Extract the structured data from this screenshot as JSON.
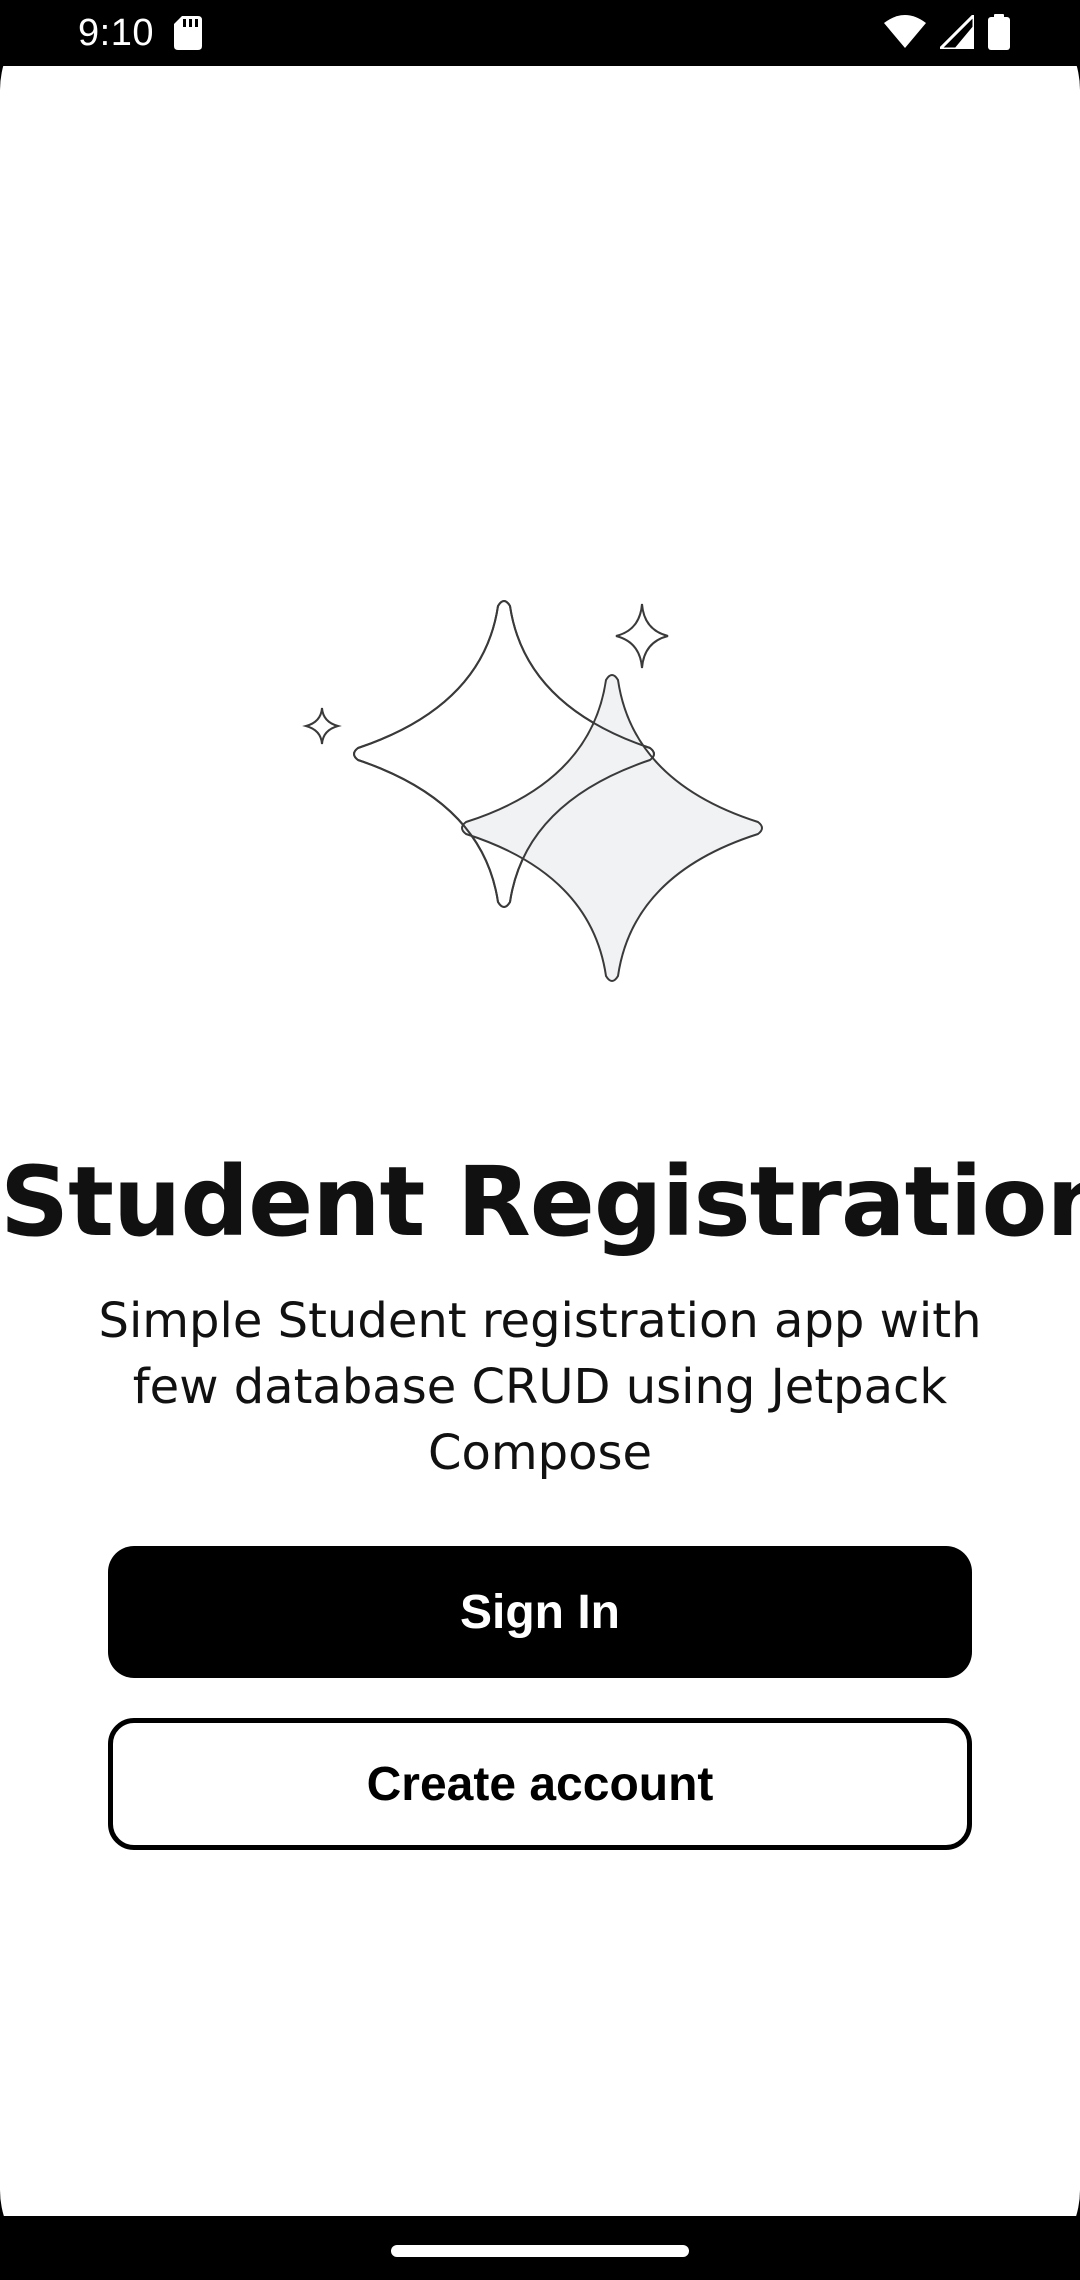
{
  "status_bar": {
    "time": "9:10",
    "icons": [
      "sd-card-icon",
      "wifi-icon",
      "cellular-signal-icon",
      "battery-icon"
    ]
  },
  "welcome": {
    "title": "Student Registration",
    "subtitle": "Simple Student registration app with few database CRUD using Jetpack Compose",
    "illustration_icon": "sparkles-illustration"
  },
  "actions": {
    "sign_in_label": "Sign In",
    "create_account_label": "Create account"
  },
  "colors": {
    "primary": "#000000",
    "background": "#ffffff",
    "illustration_fill": "#f1f2f4",
    "illustration_stroke": "#3a3a3a"
  }
}
